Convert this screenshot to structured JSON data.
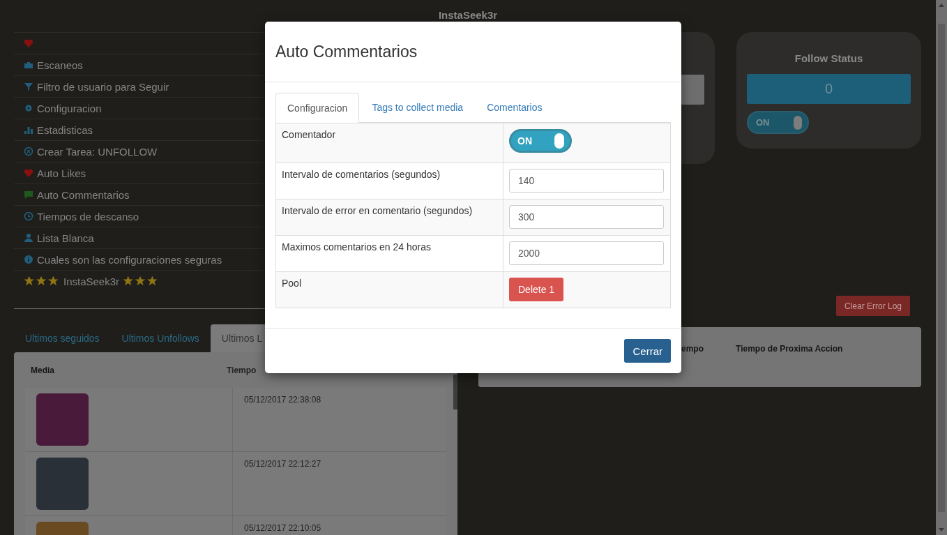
{
  "app": {
    "title": "InstaSeek3r"
  },
  "menu": [
    {
      "kind": "icon-only"
    },
    {
      "kind": "link",
      "label": "Escaneos"
    },
    {
      "kind": "link",
      "label": "Filtro de usuario para Seguir"
    },
    {
      "kind": "link",
      "label": "Configuracion"
    },
    {
      "kind": "link",
      "label": "Estadisticas"
    },
    {
      "kind": "link",
      "label": "Crear Tarea: UNFOLLOW"
    },
    {
      "kind": "link",
      "label": "Auto Likes"
    },
    {
      "kind": "link",
      "label": "Auto Commentarios"
    },
    {
      "kind": "link",
      "label": "Tiempos de descanso"
    },
    {
      "kind": "link",
      "label": "Lista Blanca"
    },
    {
      "kind": "link",
      "label": "Cuales son las configuraciones seguras"
    },
    {
      "kind": "brand",
      "label": "InstaSeek3r"
    }
  ],
  "history_tabs": [
    {
      "label": "Ultimos seguidos",
      "selected": false
    },
    {
      "label": "Ultimos Unfollows",
      "selected": false
    },
    {
      "label": "Ultimos L",
      "selected": true
    }
  ],
  "history_table": {
    "columns": [
      "Media",
      "Tiempo"
    ],
    "rows": [
      {
        "time": "05/12/2017 22:38:08"
      },
      {
        "time": "05/12/2017 22:12:27"
      },
      {
        "time": "05/12/2017 22:10:05"
      }
    ]
  },
  "follow_card": {
    "title": "Follow Status",
    "count": "0",
    "toggle": {
      "label": "ON",
      "on": true
    }
  },
  "clear_button": "Clear Error Log",
  "tasks_table": {
    "columns": [
      "empo",
      "Tiempo de Proxima Accion"
    ]
  },
  "modal": {
    "title": "Auto Commentarios",
    "tabs": [
      {
        "label": "Configuracion",
        "selected": true
      },
      {
        "label": "Tags to collect media",
        "selected": false
      },
      {
        "label": "Comentarios",
        "selected": false
      }
    ],
    "settings": [
      {
        "kind": "toggle",
        "label": "Comentador",
        "toggle_label": "ON",
        "on": true
      },
      {
        "kind": "input",
        "label": "Intervalo de comentarios (segundos)",
        "value": "140"
      },
      {
        "kind": "input",
        "label": "Intervalo de error en comentario (segundos)",
        "value": "300"
      },
      {
        "kind": "input",
        "label": "Maximos comentarios en 24 horas",
        "value": "2000"
      },
      {
        "kind": "button",
        "label": "Pool",
        "button": "Delete 1"
      }
    ],
    "close_button": "Cerrar"
  }
}
